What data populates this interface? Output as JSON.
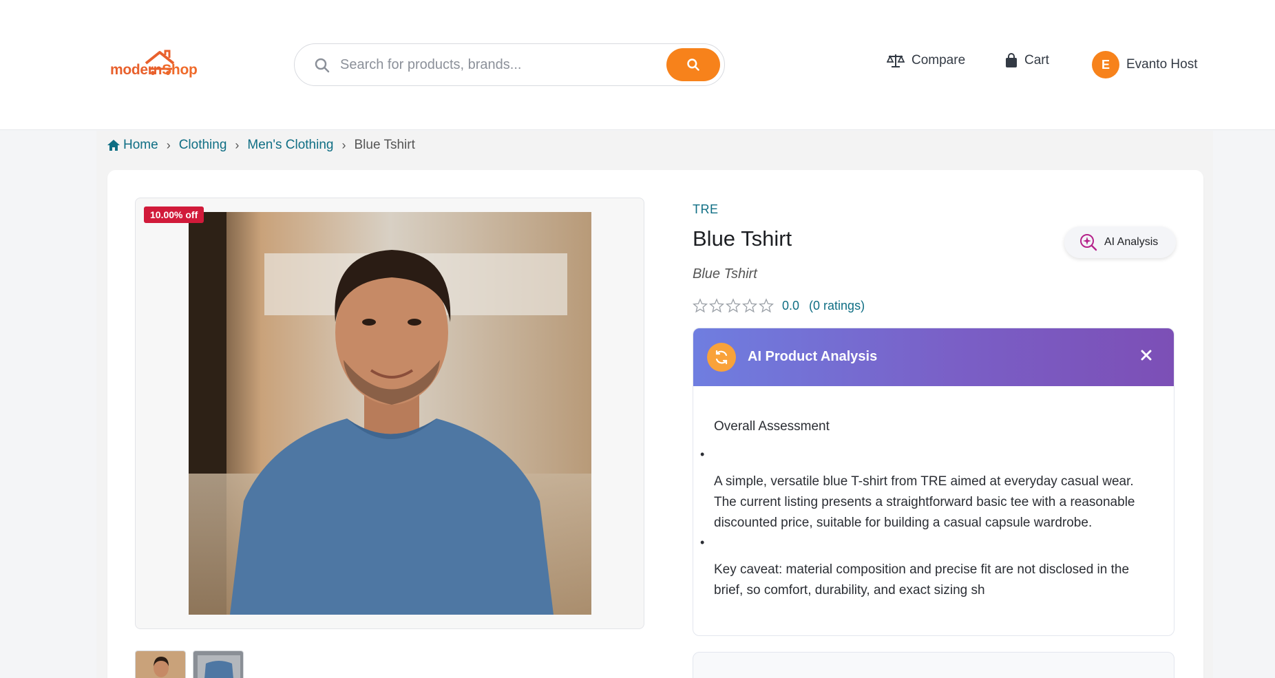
{
  "header": {
    "logo": {
      "text_modern": "modern",
      "text_shop": "Shop"
    },
    "search": {
      "placeholder": "Search for products, brands..."
    },
    "nav": {
      "compare": "Compare",
      "cart": "Cart"
    },
    "user": {
      "initial": "E",
      "name": "Evanto Host"
    }
  },
  "breadcrumb": {
    "items": [
      "Home",
      "Clothing",
      "Men's Clothing"
    ],
    "current": "Blue Tshirt"
  },
  "product": {
    "discount_badge": "10.00% off",
    "brand": "TRE",
    "title": "Blue Tshirt",
    "subtitle": "Blue Tshirt",
    "rating_value": "0.0",
    "rating_count": "(0 ratings)",
    "stars_filled": 0,
    "stars_total": 5,
    "ai_button": "AI Analysis"
  },
  "ai_panel": {
    "title": "AI Product Analysis",
    "heading": "Overall Assessment",
    "paragraphs": [
      "A simple, versatile blue T-shirt from TRE aimed at everyday casual wear. The current listing presents a straightforward basic tee with a reasonable discounted price, suitable for building a casual capsule wardrobe.",
      "Key caveat: material composition and precise fit are not disclosed in the brief, so comfort, durability, and exact sizing sh"
    ]
  },
  "colors": {
    "accent": "#f7821b",
    "link": "#0f6e84",
    "badge": "#d11a3a",
    "ai_gradient_start": "#6f7ee0",
    "ai_gradient_end": "#7c4fb6"
  }
}
